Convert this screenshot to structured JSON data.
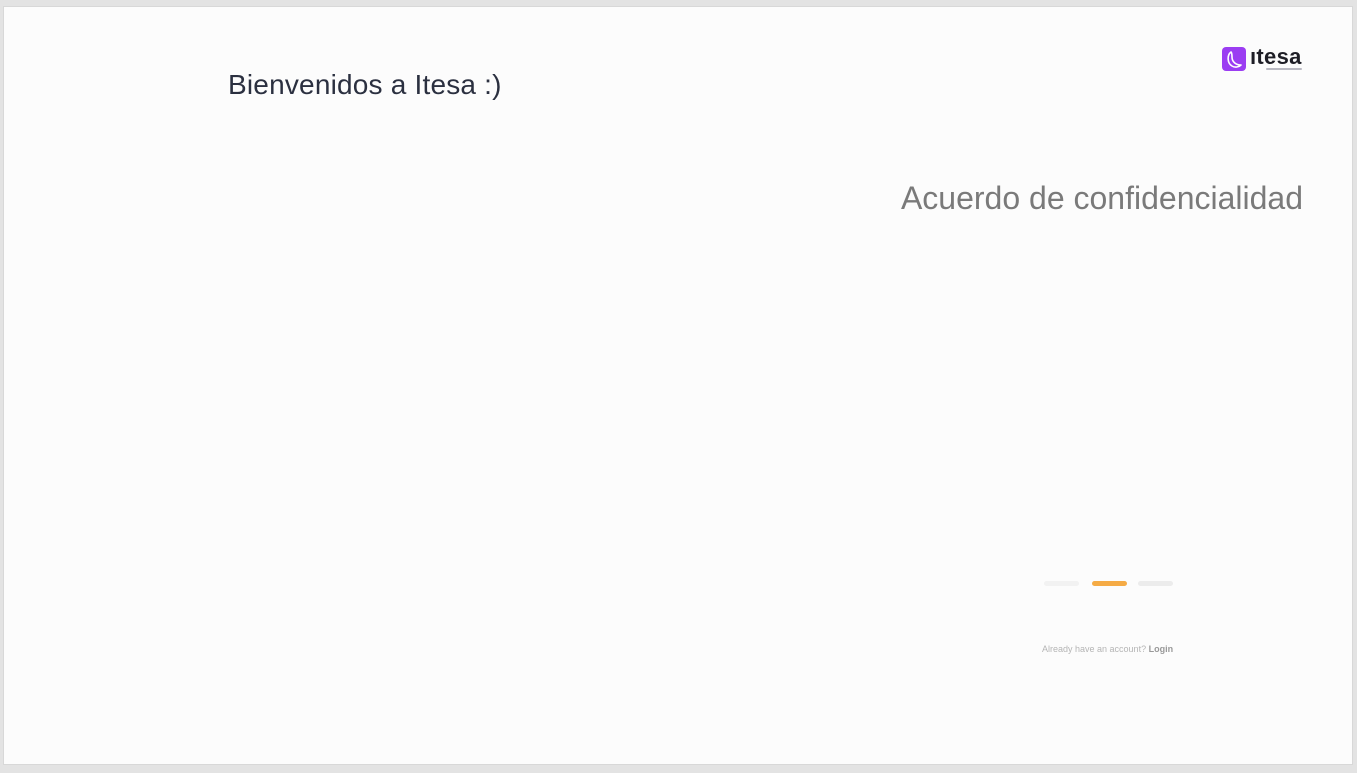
{
  "welcome": {
    "title": "Bienvenidos a Itesa :)"
  },
  "logo": {
    "icon": "crescent-moon-icon",
    "text": "ıtesa",
    "brand_color": "#9b3df2"
  },
  "section": {
    "title": "Acuerdo de confidencialidad"
  },
  "progress": {
    "steps": [
      {
        "state": "inactive",
        "color": "#f2f2f2"
      },
      {
        "state": "active",
        "color": "#f5ab45"
      },
      {
        "state": "inactive",
        "color": "#ececec"
      }
    ],
    "current_step": 2,
    "total_steps": 3
  },
  "footer": {
    "prompt": "Already have an account?",
    "login_label": "Login"
  }
}
